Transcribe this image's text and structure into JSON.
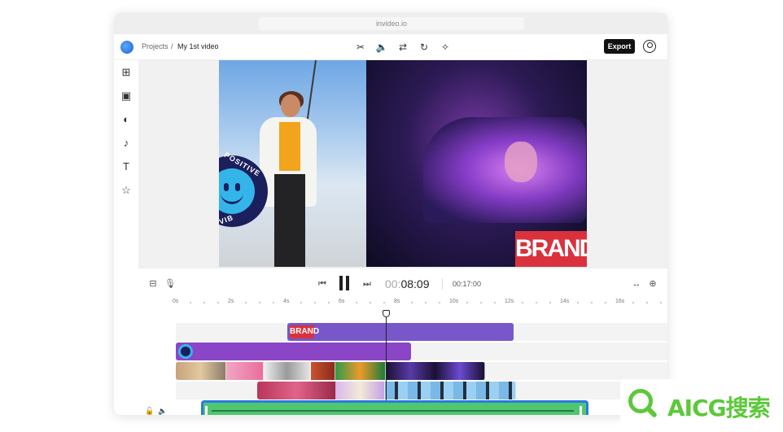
{
  "browser": {
    "url": "invideo.io"
  },
  "header": {
    "breadcrumb_root": "Projects",
    "breadcrumb_sep": "/",
    "breadcrumb_current": "My 1st video",
    "tools": [
      {
        "icon": "scissors-icon",
        "glyph": "✂"
      },
      {
        "icon": "volume-icon",
        "glyph": "🔈"
      },
      {
        "icon": "swap-icon",
        "glyph": "⇄"
      },
      {
        "icon": "rotate-icon",
        "glyph": "↻"
      },
      {
        "icon": "magic-wand-icon",
        "glyph": "✧"
      }
    ],
    "export_label": "Export"
  },
  "sidebar": [
    {
      "icon": "grid-icon",
      "glyph": "⊞"
    },
    {
      "icon": "image-icon",
      "glyph": "▣"
    },
    {
      "icon": "color-icon",
      "glyph": "◐"
    },
    {
      "icon": "music-icon",
      "glyph": "♪"
    },
    {
      "icon": "text-icon",
      "glyph": "T"
    },
    {
      "icon": "star-icon",
      "glyph": "☆"
    }
  ],
  "canvas": {
    "badge_top_text": "POSITIVE",
    "badge_side_text": "VIB",
    "brand_text": "BRAND"
  },
  "playback": {
    "current_time_faint": "00:",
    "current_time_main": "08:09",
    "total_time": "00:17:00",
    "icons": {
      "align": "⊟",
      "mic": "🎙",
      "skip_back": "⏮",
      "skip_forward": "⏭",
      "fit": "↔",
      "zoom_in": "⊕"
    }
  },
  "timeline": {
    "ruler": [
      "0s",
      "2s",
      "4s",
      "6s",
      "8s",
      "10s",
      "12s",
      "14s",
      "16s"
    ],
    "text_clip_label": "BRAND",
    "footer_icons": {
      "lock": "🔓",
      "speaker": "🔈"
    }
  },
  "watermark": {
    "text": "AICG搜索"
  }
}
